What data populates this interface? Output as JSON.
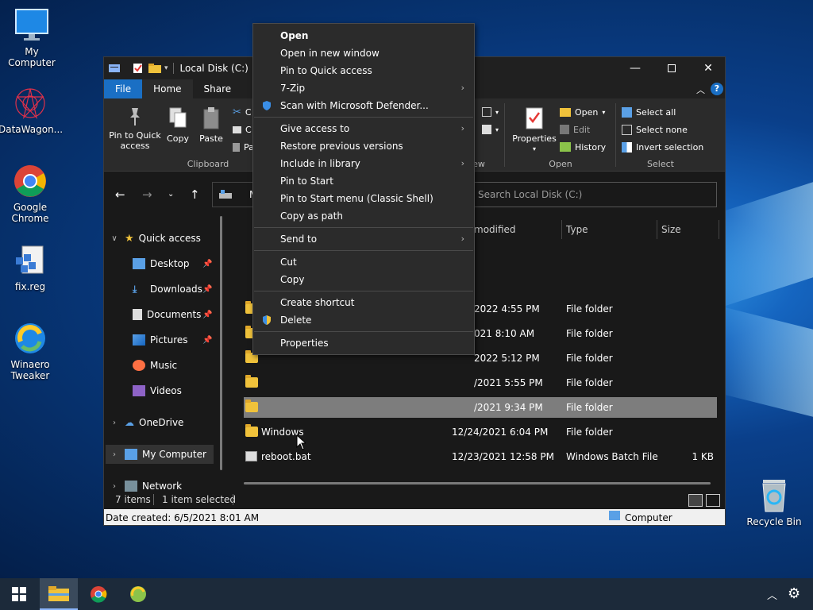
{
  "desktop": {
    "icons": [
      {
        "label": "My Computer",
        "icon": "monitor-icon"
      },
      {
        "label": "DataWagon...",
        "icon": "datawagon-icon"
      },
      {
        "label": "Google Chrome",
        "icon": "chrome-icon"
      },
      {
        "label": "fix.reg",
        "icon": "registry-icon"
      },
      {
        "label": "Winaero Tweaker",
        "icon": "winaero-icon"
      },
      {
        "label": "Recycle Bin",
        "icon": "recycle-bin-icon"
      }
    ]
  },
  "window": {
    "title": "Local Disk (C:)",
    "tabs": [
      "File",
      "Home",
      "Share"
    ],
    "ribbon": {
      "clipboard": {
        "label": "Clipboard",
        "pin": "Pin to Quick access",
        "copy": "Copy",
        "paste": "Paste"
      },
      "view_label": "ew",
      "open": {
        "label": "Open",
        "properties": "Properties",
        "open_btn": "Open",
        "edit": "Edit",
        "history": "History"
      },
      "select": {
        "label": "Select",
        "all": "Select all",
        "none": "Select none",
        "invert": "Invert selection"
      }
    },
    "search_placeholder": "Search Local Disk (C:)",
    "address_fragment": "M",
    "tree": [
      {
        "label": "Quick access"
      },
      {
        "label": "Desktop"
      },
      {
        "label": "Downloads"
      },
      {
        "label": "Documents"
      },
      {
        "label": "Pictures"
      },
      {
        "label": "Music"
      },
      {
        "label": "Videos"
      },
      {
        "label": "OneDrive"
      },
      {
        "label": "My Computer"
      },
      {
        "label": "Network"
      }
    ],
    "columns": {
      "modified": "modified",
      "type": "Type",
      "size": "Size"
    },
    "rows": [
      {
        "name": "",
        "date": "2022 4:55 PM",
        "type": "File folder",
        "size": ""
      },
      {
        "name": "",
        "date": "021 8:10 AM",
        "type": "File folder",
        "size": ""
      },
      {
        "name": "",
        "date": "2022 5:12 PM",
        "type": "File folder",
        "size": ""
      },
      {
        "name": "",
        "date": "/2021 5:55 PM",
        "type": "File folder",
        "size": ""
      },
      {
        "name": "",
        "date": "/2021 9:34 PM",
        "type": "File folder",
        "size": ""
      },
      {
        "name": "Windows",
        "date": "12/24/2021 6:04 PM",
        "type": "File folder",
        "size": ""
      },
      {
        "name": "reboot.bat",
        "date": "12/23/2021 12:58 PM",
        "type": "Windows Batch File",
        "size": "1 KB"
      }
    ],
    "status": {
      "items": "7 items",
      "selected": "1 item selected"
    },
    "bottom": {
      "date_created": "Date created: 6/5/2021 8:01 AM",
      "location": "Computer"
    }
  },
  "context_menu": {
    "items": [
      {
        "label": "Open",
        "bold": true
      },
      {
        "label": "Open in new window"
      },
      {
        "label": "Pin to Quick access"
      },
      {
        "label": "7-Zip",
        "submenu": true
      },
      {
        "label": "Scan with Microsoft Defender...",
        "icon": "defender-shield-icon"
      },
      {
        "label": "Give access to",
        "submenu": true
      },
      {
        "label": "Restore previous versions"
      },
      {
        "label": "Include in library",
        "submenu": true
      },
      {
        "label": "Pin to Start"
      },
      {
        "label": "Pin to Start menu (Classic Shell)"
      },
      {
        "label": "Copy as path"
      },
      {
        "label": "Send to",
        "submenu": true
      },
      {
        "label": "Cut"
      },
      {
        "label": "Copy"
      },
      {
        "label": "Create shortcut"
      },
      {
        "label": "Delete",
        "icon": "uac-shield-icon"
      },
      {
        "label": "Properties"
      }
    ]
  },
  "colors": {
    "accent": "#1a6fc4",
    "folder": "#f0c23b",
    "selection": "#7d7d7d"
  }
}
